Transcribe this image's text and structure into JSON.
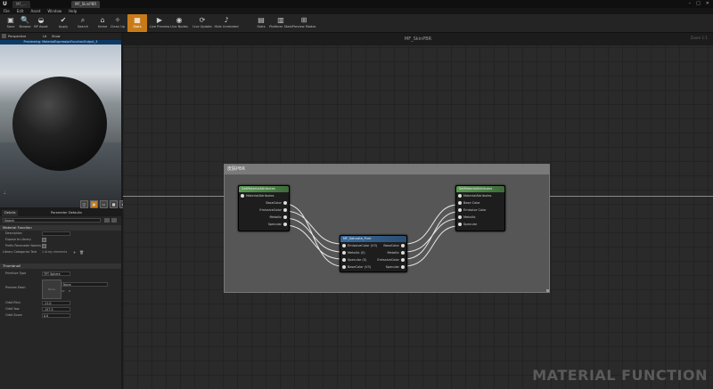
{
  "window": {
    "logo": "U",
    "tabs": [
      "MF_...",
      "MF_SkinPBR"
    ]
  },
  "menu": [
    "File",
    "Edit",
    "Asset",
    "Window",
    "Help"
  ],
  "toolbar": [
    {
      "label": "Save",
      "icon": "save-icon",
      "glyph": "▣",
      "active": false
    },
    {
      "label": "Browse",
      "icon": "browse-icon",
      "glyph": "🔍",
      "active": false
    },
    {
      "label": "BP Asset",
      "icon": "bp-asset-icon",
      "glyph": "◒",
      "active": false
    },
    {
      "label": "Apply",
      "icon": "apply-icon",
      "glyph": "✔",
      "active": false
    },
    {
      "label": "Search",
      "icon": "search-icon",
      "glyph": "⌕",
      "active": false
    },
    {
      "label": "Home",
      "icon": "home-icon",
      "glyph": "⌂",
      "active": false
    },
    {
      "label": "Clean Up",
      "icon": "clean-up-icon",
      "glyph": "✧",
      "active": false
    },
    {
      "label": "Stats",
      "icon": "stats-icon",
      "glyph": "▦",
      "active": true
    },
    {
      "label": "Live Preview",
      "icon": "live-preview-icon",
      "glyph": "▶",
      "active": false
    },
    {
      "label": "Live Nodes",
      "icon": "live-nodes-icon",
      "glyph": "◉",
      "active": false
    },
    {
      "label": "Live Update",
      "icon": "live-update-icon",
      "glyph": "⟳",
      "active": false
    },
    {
      "label": "Hide Unrelated",
      "icon": "hide-unrelated-icon",
      "glyph": "♪",
      "active": false
    },
    {
      "label": "Stats",
      "icon": "stats-panel-icon",
      "glyph": "▤",
      "active": false
    },
    {
      "label": "Platform Stats",
      "icon": "platform-stats-icon",
      "glyph": "▥",
      "active": false
    },
    {
      "label": "Preview Modes",
      "icon": "preview-modes-icon",
      "glyph": "⊞",
      "active": false
    }
  ],
  "viewport": {
    "mode_label": "Perspective",
    "lit_label": "Lit",
    "show_label": "Show",
    "info": "Previewing: MaterialExpressionFunctionOutput_3"
  },
  "details": {
    "tab_details": "Details",
    "tab_params": "Parameter Defaults",
    "search_placeholder": "Search",
    "section_function": "Material Function",
    "description_label": "Description",
    "description_value": "",
    "expose_label": "Expose to Library",
    "prefix_label": "Prefix Parameter Names",
    "library_label": "Library Categories Text",
    "library_value": "1 Array elements",
    "section_thumbnail": "Thumbnail",
    "primitive_label": "Primitive Type",
    "primitive_value": "TPT Sphere",
    "preview_mesh_label": "Preview Mesh",
    "preview_mesh_value": "None",
    "preview_mesh_thumb": "None",
    "orbit_pitch_label": "Orbit Pitch",
    "orbit_pitch_value": "-11.0",
    "orbit_yaw_label": "Orbit Yaw",
    "orbit_yaw_value": "-157.5",
    "orbit_zoom_label": "Orbit Zoom",
    "orbit_zoom_value": "0.0"
  },
  "graph": {
    "title": "MF_SkinPBR",
    "zoom": "Zoom 1:1",
    "watermark": "MATERIAL FUNCTION",
    "comment": "皮肤PBR",
    "node_get": {
      "title": "GetMaterialAttributes",
      "input": "MaterialAttributes",
      "outputs": [
        "BaseColor",
        "EmissiveColor",
        "Metallic",
        "Specular"
      ]
    },
    "node_mf": {
      "title": "MF_Saturate_Pure",
      "inputs": [
        "EmissiveColor (V3)",
        "Metallic (S)",
        "Specular (S)",
        "BaseColor (V3)"
      ],
      "outputs": [
        "BaseColor",
        "Metallic",
        "EmissiveColor",
        "Specular"
      ]
    },
    "node_set": {
      "title": "SetMaterialAttributes",
      "inputs": [
        "MaterialAttributes",
        "Base Color",
        "Emissive Color",
        "Metallic",
        "Specular"
      ]
    }
  }
}
